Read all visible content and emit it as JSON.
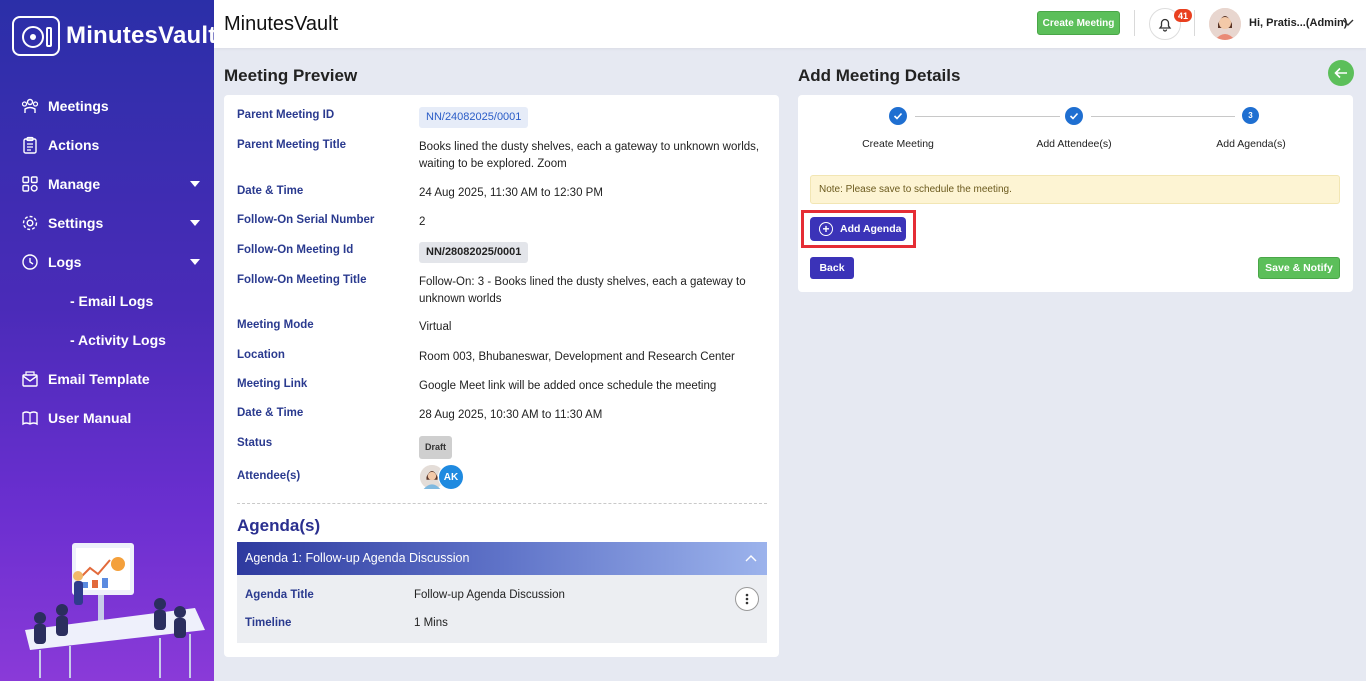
{
  "brand": {
    "name": "MinutesVault"
  },
  "header": {
    "title": "MinutesVault",
    "create_meeting": "Create Meeting",
    "notification_count": "41",
    "user_greeting": "Hi, Pratis...(Admin)"
  },
  "sidebar": {
    "items": [
      {
        "label": "Meetings",
        "icon": "meetings-icon"
      },
      {
        "label": "Actions",
        "icon": "clipboard-icon"
      },
      {
        "label": "Manage",
        "icon": "grid-icon"
      },
      {
        "label": "Settings",
        "icon": "gear-icon"
      },
      {
        "label": "Logs",
        "icon": "history-icon"
      },
      {
        "label": "- Email Logs"
      },
      {
        "label": "- Activity Logs"
      },
      {
        "label": "Email Template",
        "icon": "mail-icon"
      },
      {
        "label": "User Manual",
        "icon": "book-icon"
      }
    ]
  },
  "preview": {
    "title": "Meeting Preview",
    "fields": [
      {
        "label": "Parent Meeting ID",
        "value": "NN/24082025/0001"
      },
      {
        "label": "Parent Meeting Title",
        "value": "Books lined the dusty shelves, each a gateway to unknown worlds, waiting to be explored. Zoom"
      },
      {
        "label": "Date & Time",
        "value": "24 Aug 2025, 11:30 AM to 12:30 PM"
      },
      {
        "label": "Follow-On Serial Number",
        "value": "2"
      },
      {
        "label": "Follow-On Meeting Id",
        "value": "NN/28082025/0001"
      },
      {
        "label": "Follow-On Meeting Title",
        "value": "Follow-On: 3 - Books lined the dusty shelves, each a gateway to unknown worlds"
      },
      {
        "label": "Meeting Mode",
        "value": "Virtual"
      },
      {
        "label": "Location",
        "value": "Room 003, Bhubaneswar, Development and Research Center"
      },
      {
        "label": "Meeting Link",
        "value": "Google Meet link will be added once schedule the meeting"
      },
      {
        "label": "Date & Time",
        "value": "28 Aug 2025, 10:30 AM to 11:30 AM"
      },
      {
        "label": "Status",
        "value": "Draft"
      },
      {
        "label": "Attendee(s)",
        "value": "AK"
      }
    ],
    "agenda_heading": "Agenda(s)",
    "agenda": {
      "header": "Agenda 1: Follow-up Agenda Discussion",
      "title_label": "Agenda Title",
      "title_value": "Follow-up Agenda Discussion",
      "timeline_label": "Timeline",
      "timeline_value": "1 Mins"
    }
  },
  "details": {
    "title": "Add Meeting Details",
    "steps": [
      {
        "label": "Create Meeting",
        "state": "done"
      },
      {
        "label": "Add Attendee(s)",
        "state": "done"
      },
      {
        "label": "Add Agenda(s)",
        "state": "current",
        "number": "3"
      }
    ],
    "note": "Note: Please save to schedule the meeting.",
    "add_agenda": "Add Agenda",
    "back": "Back",
    "save_notify": "Save & Notify"
  },
  "colors": {
    "primary": "#3b33b8",
    "success": "#5cbf5a",
    "label": "#2a3a8f",
    "highlight": "#e52d35",
    "step": "#1f6fd1"
  }
}
